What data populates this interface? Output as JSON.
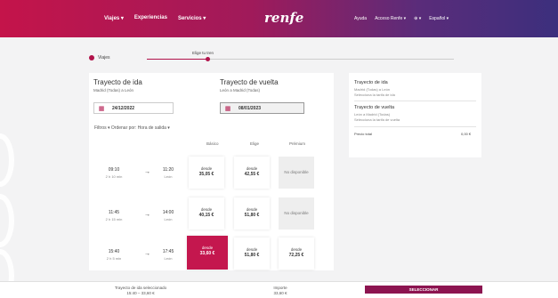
{
  "header": {
    "nav_left": [
      "Viajes ▾",
      "Experiencias",
      "Servicios ▾"
    ],
    "logo": "renfe",
    "nav_right": [
      "Ayuda",
      "Acceso Renfe ▾",
      "⊕ ▾",
      "Español ▾"
    ]
  },
  "stepper": {
    "step1": "Viajes",
    "step2": "Elige tu tren"
  },
  "outbound": {
    "title": "Trayecto de ida",
    "route": "Madrid (Todas) a León",
    "date": "24/12/2022"
  },
  "return": {
    "title": "Trayecto de vuelta",
    "route": "León a Madrid (Todas)",
    "date": "08/01/2023"
  },
  "filters": "Filtros  ▾   Ordenar por: Hora de salida  ▾",
  "columns": [
    "Básico",
    "Elige",
    "Prémium"
  ],
  "rows": [
    {
      "dep": "09:10",
      "dep_sub": "2 h 10 min",
      "arr": "11:20",
      "arr_sub": "León",
      "fares": [
        {
          "label": "desde",
          "price": "35,05 €",
          "state": "normal"
        },
        {
          "label": "desde",
          "price": "42,55 €",
          "state": "normal"
        },
        {
          "label": "No disponible",
          "price": "",
          "state": "na"
        }
      ]
    },
    {
      "dep": "11:45",
      "dep_sub": "2 h 15 min",
      "arr": "14:00",
      "arr_sub": "León",
      "fares": [
        {
          "label": "desde",
          "price": "40,15 €",
          "state": "normal"
        },
        {
          "label": "desde",
          "price": "51,80 €",
          "state": "normal"
        },
        {
          "label": "No disponible",
          "price": "",
          "state": "na"
        }
      ]
    },
    {
      "dep": "15:40",
      "dep_sub": "2 h 5 min",
      "arr": "17:45",
      "arr_sub": "León",
      "fares": [
        {
          "label": "desde",
          "price": "33,60 €",
          "state": "selected"
        },
        {
          "label": "desde",
          "price": "51,80 €",
          "state": "normal"
        },
        {
          "label": "desde",
          "price": "72,25 €",
          "state": "normal"
        }
      ]
    }
  ],
  "summary": {
    "ida_title": "Trayecto de ida",
    "ida_route": "Madrid (Todas) a León",
    "ida_detail": "Selecciona la tarifa de ida",
    "vuelta_title": "Trayecto de vuelta",
    "vuelta_route": "León a Madrid (Todas)",
    "vuelta_detail": "Selecciona la tarifa de vuelta",
    "total_label": "Precio total",
    "total_value": "0,00 €"
  },
  "bottom": {
    "left_line1": "Trayecto de ida seleccionado",
    "left_line2": "15:40 – 33,60 €",
    "mid_line1": "Importe",
    "mid_line2": "33,60 €",
    "button": "SELECCIONAR"
  },
  "colors": {
    "brand": "#c4174e",
    "button": "#8c1450"
  }
}
